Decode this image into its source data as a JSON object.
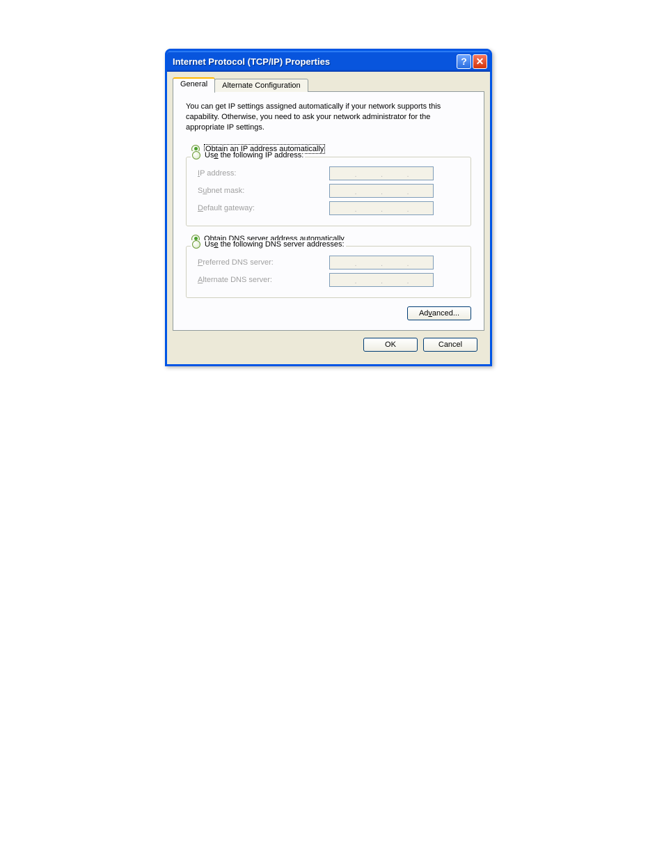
{
  "window": {
    "title": "Internet Protocol (TCP/IP) Properties"
  },
  "tabs": {
    "general": "General",
    "alternate": "Alternate Configuration"
  },
  "description": "You can get IP settings assigned automatically if your network supports this capability. Otherwise, you need to ask your network administrator for the appropriate IP settings.",
  "ip": {
    "auto_label_pre": "O",
    "auto_label_rest": "btain an IP address automatically",
    "auto_selected": true,
    "manual_label_pre": "Us",
    "manual_label_u": "e",
    "manual_label_post": " the following IP address:",
    "fields": {
      "ip_addr_pre": "I",
      "ip_addr_post": "P address:",
      "subnet_pre": "S",
      "subnet_u": "u",
      "subnet_post": "bnet mask:",
      "gateway_pre": "D",
      "gateway_post": "efault gateway:"
    }
  },
  "dns": {
    "auto_label_pre": "O",
    "auto_label_u": "b",
    "auto_label_post": "tain DNS server address automatically",
    "auto_selected": true,
    "manual_label_pre": "Us",
    "manual_label_u": "e",
    "manual_label_post": " the following DNS server addresses:",
    "fields": {
      "preferred_pre": "P",
      "preferred_post": "referred DNS server:",
      "alternate_pre": "A",
      "alternate_post": "lternate DNS server:"
    }
  },
  "buttons": {
    "advanced_pre": "Ad",
    "advanced_u": "v",
    "advanced_post": "anced...",
    "ok": "OK",
    "cancel": "Cancel"
  }
}
